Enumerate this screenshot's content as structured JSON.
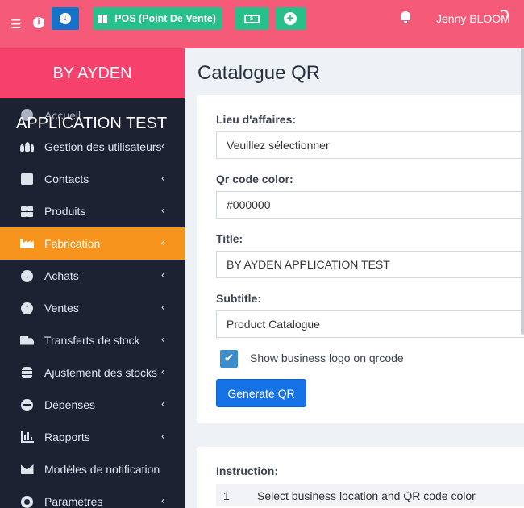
{
  "topbar": {
    "pos_label": "POS (Point De Vente)",
    "user_name": "Jenny BLOOM",
    "info_glyph": "i",
    "download_glyph": "↓",
    "add_glyph": "+",
    "cash_glyph": "$",
    "background_color": "#f65a79"
  },
  "sidebar": {
    "brand": "BY AYDEN",
    "app_title": "APPLICATION TEST",
    "items": [
      {
        "label": "Accueil",
        "icon": "dashboard-icon"
      },
      {
        "label": "Gestion des utilisateurs",
        "icon": "users-icon"
      },
      {
        "label": "Contacts",
        "icon": "address-book-icon"
      },
      {
        "label": "Produits",
        "icon": "cubes-icon"
      },
      {
        "label": "Fabrication",
        "icon": "industry-icon",
        "active": true
      },
      {
        "label": "Achats",
        "icon": "arrow-circle-down-icon"
      },
      {
        "label": "Ventes",
        "icon": "arrow-circle-up-icon"
      },
      {
        "label": "Transferts de stock",
        "icon": "truck-icon"
      },
      {
        "label": "Ajustement des stocks",
        "icon": "database-icon"
      },
      {
        "label": "Dépenses",
        "icon": "minus-circle-icon"
      },
      {
        "label": "Rapports",
        "icon": "bar-chart-icon"
      },
      {
        "label": "Modèles de notification",
        "icon": "envelope-icon"
      },
      {
        "label": "Paramètres",
        "icon": "cog-icon"
      }
    ],
    "chevron": "‹",
    "active_color": "#f7941d",
    "brand_color": "#f5416c"
  },
  "main": {
    "page_title": "Catalogue QR",
    "form": {
      "location_label": "Lieu d'affaires:",
      "location_value": "Veuillez sélectionner",
      "qr_color_label": "Qr code color:",
      "qr_color_value": "#000000",
      "title_label": "Title:",
      "title_value": "BY AYDEN APPLICATION TEST",
      "subtitle_label": "Subtitle:",
      "subtitle_value": "Product Catalogue",
      "show_logo_label": "Show business logo on qrcode",
      "show_logo_checked": true,
      "checkmark": "✔",
      "generate_label": "Generate QR"
    },
    "instruction": {
      "title": "Instruction:",
      "rows": [
        {
          "num": "1",
          "text": "Select business location and QR code color"
        }
      ]
    }
  }
}
